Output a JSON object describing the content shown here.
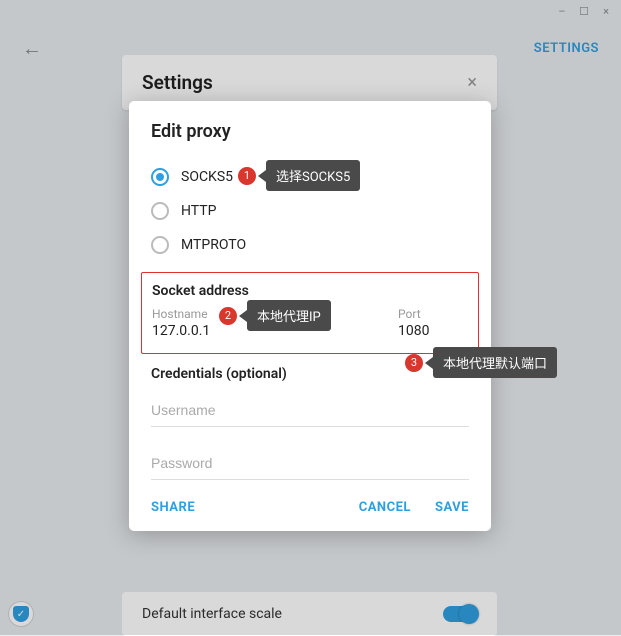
{
  "window": {
    "minimize": "–",
    "maximize": "☐",
    "close": "×"
  },
  "topbar": {
    "settings_link": "SETTINGS"
  },
  "settings_panel": {
    "title": "Settings",
    "close": "×"
  },
  "scale": {
    "label": "Default interface scale"
  },
  "dialog": {
    "title": "Edit proxy",
    "proxy_types": [
      {
        "label": "SOCKS5",
        "selected": true
      },
      {
        "label": "HTTP",
        "selected": false
      },
      {
        "label": "MTPROTO",
        "selected": false
      }
    ],
    "socket": {
      "title": "Socket address",
      "hostname_label": "Hostname",
      "hostname_value": "127.0.0.1",
      "port_label": "Port",
      "port_value": "1080"
    },
    "credentials": {
      "title": "Credentials (optional)",
      "username_placeholder": "Username",
      "password_placeholder": "Password"
    },
    "actions": {
      "share": "SHARE",
      "cancel": "CANCEL",
      "save": "SAVE"
    }
  },
  "annotations": {
    "a1": {
      "num": "1",
      "text": "选择SOCKS5"
    },
    "a2": {
      "num": "2",
      "text": "本地代理IP"
    },
    "a3": {
      "num": "3",
      "text": "本地代理默认端口"
    }
  }
}
